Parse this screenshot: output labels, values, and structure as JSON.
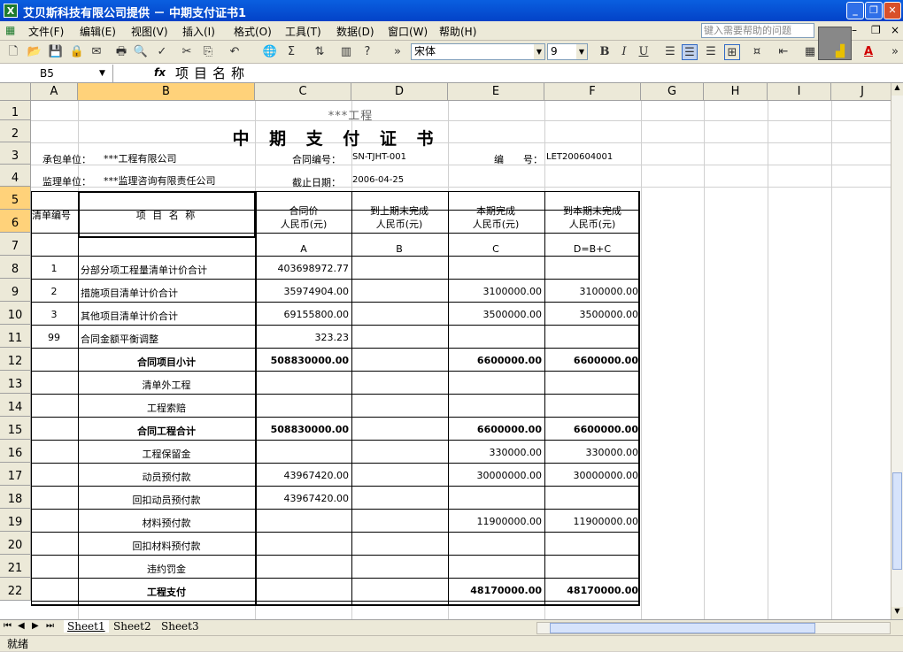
{
  "window": {
    "title": "艾贝斯科技有限公司提供 － 中期支付证书1"
  },
  "menu": [
    "文件(F)",
    "编辑(E)",
    "视图(V)",
    "插入(I)",
    "格式(O)",
    "工具(T)",
    "数据(D)",
    "窗口(W)",
    "帮助(H)"
  ],
  "help_placeholder": "键入需要帮助的问题",
  "toolbar": {
    "font": "宋体",
    "size": "9"
  },
  "formula_bar": {
    "cell": "B5",
    "value": "项目名称"
  },
  "columns": [
    "A",
    "B",
    "C",
    "D",
    "E",
    "F",
    "G",
    "H",
    "I",
    "J"
  ],
  "rows": [
    "1",
    "2",
    "3",
    "4",
    "5",
    "6",
    "7",
    "8",
    "9",
    "10",
    "11",
    "12",
    "13",
    "14",
    "15",
    "16",
    "17",
    "18",
    "19",
    "20",
    "21",
    "22"
  ],
  "sheet": {
    "project": "***工程",
    "title": "中 期 支 付 证 书",
    "contractor_label": "承包单位：",
    "contractor": "***工程有限公司",
    "contract_no_label": "合同编号：",
    "contract_no": "SN-TJHT-001",
    "number_label": "编　　号：",
    "number": "LET200604001",
    "supervisor_label": "监理单位：",
    "supervisor": "***监理咨询有限责任公司",
    "deadline_label": "截止日期：",
    "deadline": "2006-04-25",
    "headers": {
      "code": "清单编号",
      "name": "项 目 名 称",
      "c1": "合同价",
      "c1u": "人民币(元)",
      "d1": "到上期末完成",
      "d1u": "人民币(元)",
      "e1": "本期完成",
      "e1u": "人民币(元)",
      "f1": "到本期末完成",
      "f1u": "人民币(元)"
    },
    "letters": {
      "c": "A",
      "d": "B",
      "e": "C",
      "f": "D=B+C"
    },
    "data_rows": [
      {
        "code": "1",
        "name": "分部分项工程量清单计价合计",
        "c": "403698972.77",
        "d": "",
        "e": "",
        "f": ""
      },
      {
        "code": "2",
        "name": "措施项目清单计价合计",
        "c": "35974904.00",
        "d": "",
        "e": "3100000.00",
        "f": "3100000.00"
      },
      {
        "code": "3",
        "name": "其他项目清单计价合计",
        "c": "69155800.00",
        "d": "",
        "e": "3500000.00",
        "f": "3500000.00"
      },
      {
        "code": "99",
        "name": "合同金额平衡调整",
        "c": "323.23",
        "d": "",
        "e": "",
        "f": ""
      },
      {
        "code": "",
        "name": "合同项目小计",
        "c": "508830000.00",
        "d": "",
        "e": "6600000.00",
        "f": "6600000.00"
      },
      {
        "code": "",
        "name": "清单外工程",
        "c": "",
        "d": "",
        "e": "",
        "f": ""
      },
      {
        "code": "",
        "name": "工程索赔",
        "c": "",
        "d": "",
        "e": "",
        "f": ""
      },
      {
        "code": "",
        "name": "合同工程合计",
        "c": "508830000.00",
        "d": "",
        "e": "6600000.00",
        "f": "6600000.00"
      },
      {
        "code": "",
        "name": "工程保留金",
        "c": "",
        "d": "",
        "e": "330000.00",
        "f": "330000.00"
      },
      {
        "code": "",
        "name": "动员预付款",
        "c": "43967420.00",
        "d": "",
        "e": "30000000.00",
        "f": "30000000.00"
      },
      {
        "code": "",
        "name": "回扣动员预付款",
        "c": "43967420.00",
        "d": "",
        "e": "",
        "f": ""
      },
      {
        "code": "",
        "name": "材料预付款",
        "c": "",
        "d": "",
        "e": "11900000.00",
        "f": "11900000.00"
      },
      {
        "code": "",
        "name": "回扣材料预付款",
        "c": "",
        "d": "",
        "e": "",
        "f": ""
      },
      {
        "code": "",
        "name": "违约罚金",
        "c": "",
        "d": "",
        "e": "",
        "f": ""
      },
      {
        "code": "",
        "name": "工程支付",
        "c": "",
        "d": "",
        "e": "48170000.00",
        "f": "48170000.00"
      }
    ]
  },
  "tabs": [
    "Sheet1",
    "Sheet2",
    "Sheet3"
  ],
  "status": "就绪"
}
